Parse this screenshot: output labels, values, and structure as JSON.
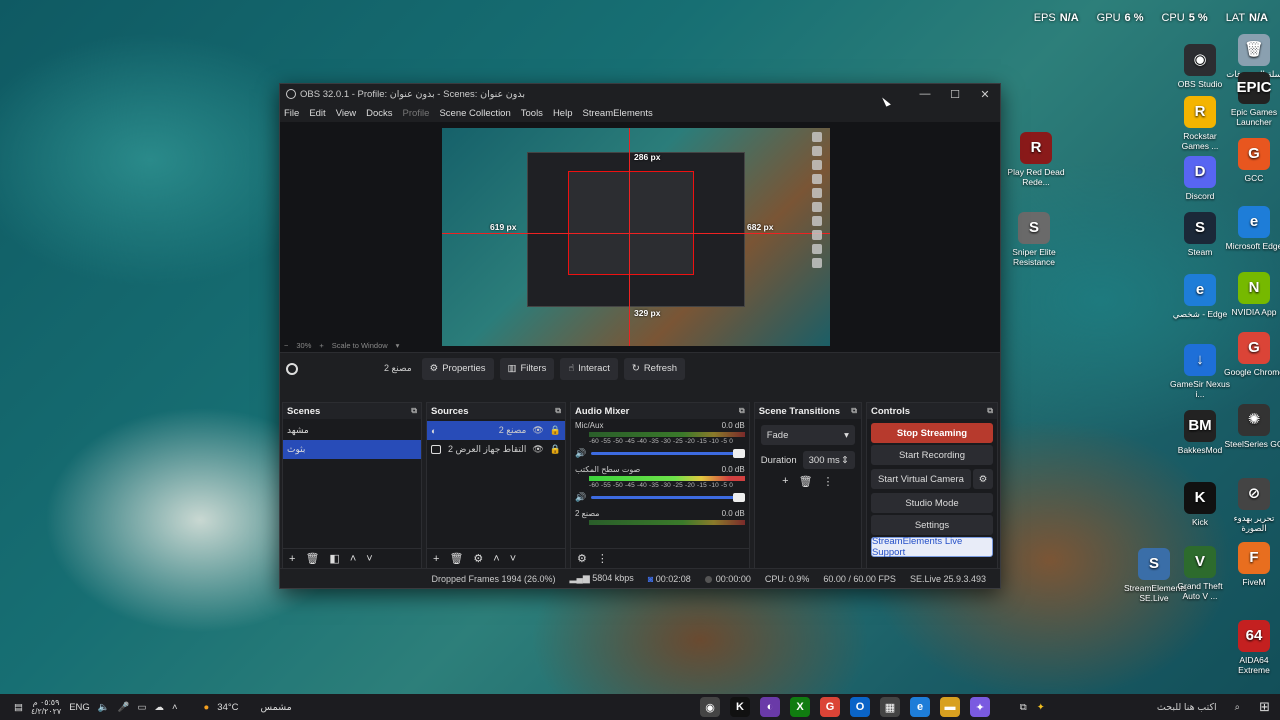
{
  "overlay_stats": {
    "eps_label": "EPS",
    "eps": "N/A",
    "gpu_label": "GPU",
    "gpu": "6 %",
    "cpu_label": "CPU",
    "cpu": "5 %",
    "lat_label": "LAT",
    "lat": "N/A"
  },
  "desktop_icons_right": [
    {
      "label": "سلة المحذوفات",
      "color": "#8aa0b0",
      "glyph": "🗑"
    },
    {
      "label": "OBS Studio",
      "color": "#2c2d31",
      "glyph": "◉"
    },
    {
      "label": "Epic Games Launcher",
      "color": "#222",
      "glyph": "EPIC"
    },
    {
      "label": "Rockstar Games ...",
      "color": "#f4b400",
      "glyph": "R"
    },
    {
      "label": "GCC",
      "color": "#e8561f",
      "glyph": "G"
    },
    {
      "label": "Discord",
      "color": "#5865f2",
      "glyph": "D"
    },
    {
      "label": "Microsoft Edge",
      "color": "#1e7dd8",
      "glyph": "e"
    },
    {
      "label": "Steam",
      "color": "#1b2838",
      "glyph": "S"
    },
    {
      "label": "NVIDIA App",
      "color": "#76b900",
      "glyph": "N"
    },
    {
      "label": "شخصي - Edge",
      "color": "#1e7dd8",
      "glyph": "e"
    },
    {
      "label": "Google Chrome",
      "color": "#db4437",
      "glyph": "G"
    },
    {
      "label": "GameSir Nexus i...",
      "color": "#1e6fd8",
      "glyph": "↓"
    },
    {
      "label": "SteelSeries GG",
      "color": "#333",
      "glyph": "✺"
    },
    {
      "label": "BakkesMod",
      "color": "#222",
      "glyph": "BM"
    },
    {
      "label": "تحرير بهدوء الصورة",
      "color": "#444",
      "glyph": "⊘"
    },
    {
      "label": "Kick",
      "color": "#111",
      "glyph": "K"
    },
    {
      "label": "StreamElements SE.Live",
      "color": "#3a6ea8",
      "glyph": "S"
    },
    {
      "label": "Grand Theft Auto V ...",
      "color": "#2d6b2d",
      "glyph": "V"
    },
    {
      "label": "FiveM",
      "color": "#e86e1f",
      "glyph": "F"
    },
    {
      "label": "AIDA64 Extreme",
      "color": "#c42020",
      "glyph": "64"
    }
  ],
  "desktop_icons_mid": [
    {
      "label": "Play Red Dead Rede...",
      "color": "#8a1a1a",
      "glyph": "R"
    },
    {
      "label": "Sniper Elite Resistance",
      "color": "#6a6a6a",
      "glyph": "S"
    }
  ],
  "obs": {
    "title": "OBS 32.0.1 - Profile: بدون عنوان - Scenes: بدون عنوان",
    "menu": [
      "File",
      "Edit",
      "View",
      "Docks",
      "Profile",
      "Scene Collection",
      "Tools",
      "Help",
      "StreamElements"
    ],
    "preview_labels": {
      "top": "286 px",
      "left": "619 px",
      "right": "682 px",
      "bottom": "329 px"
    },
    "zoom": {
      "minus": "−",
      "value": "30%",
      "plus": "+",
      "mode": "Scale to Window"
    },
    "current_scene": "مصنع 2",
    "toolbar": {
      "properties": "Properties",
      "filters": "Filters",
      "interact": "Interact",
      "refresh": "Refresh"
    },
    "scenes": {
      "title": "Scenes",
      "items": [
        "مشهد",
        "بثوث"
      ]
    },
    "sources": {
      "title": "Sources",
      "items": [
        "مصنع 2",
        "التقاط جهاز العرض 2"
      ]
    },
    "mixer": {
      "title": "Audio Mixer",
      "channels": [
        {
          "name": "Mic/Aux",
          "db": "0.0 dB"
        },
        {
          "name": "صوت سطح المكتب",
          "db": "0.0 dB"
        },
        {
          "name": "مصنع 2",
          "db": "0.0 dB"
        }
      ],
      "ticks": "-60 -55 -50 -45 -40 -35 -30 -25 -20 -15 -10 -5 0"
    },
    "transitions": {
      "title": "Scene Transitions",
      "type": "Fade",
      "duration_label": "Duration",
      "duration": "300 ms"
    },
    "controls": {
      "title": "Controls",
      "stop_streaming": "Stop Streaming",
      "start_recording": "Start Recording",
      "start_virtual_camera": "Start Virtual Camera",
      "studio_mode": "Studio Mode",
      "settings": "Settings",
      "support": "StreamElements Live Support"
    },
    "status": {
      "dropped": "Dropped Frames 1994 (26.0%)",
      "bitrate": "5804 kbps",
      "stream_time": "00:02:08",
      "rec_time": "00:00:00",
      "cpu": "CPU: 0.9%",
      "fps": "60.00 / 60.00 FPS",
      "version": "SE.Live 25.9.3.493"
    }
  },
  "taskbar": {
    "clock_time": "٠٥:٥٩ م",
    "clock_date": "٤/٢/٢٠٢٧",
    "lang": "ENG",
    "weather_temp": "34°C",
    "weather_text": "مشمس",
    "search_placeholder": "اكتب هنا للبحث",
    "apps": [
      {
        "name": "obs",
        "color": "#444",
        "glyph": "◉"
      },
      {
        "name": "kick",
        "color": "#111",
        "glyph": "K"
      },
      {
        "name": "app",
        "color": "#6a3aa8",
        "glyph": "◐"
      },
      {
        "name": "xbox",
        "color": "#107c10",
        "glyph": "X"
      },
      {
        "name": "chrome",
        "color": "#db4437",
        "glyph": "G"
      },
      {
        "name": "outlook",
        "color": "#0a64c8",
        "glyph": "O"
      },
      {
        "name": "store",
        "color": "#444",
        "glyph": "▦"
      },
      {
        "name": "edge",
        "color": "#1e7dd8",
        "glyph": "e"
      },
      {
        "name": "explorer",
        "color": "#d8a020",
        "glyph": "▬"
      },
      {
        "name": "copilot",
        "color": "#7a5ae0",
        "glyph": "✦"
      }
    ]
  }
}
